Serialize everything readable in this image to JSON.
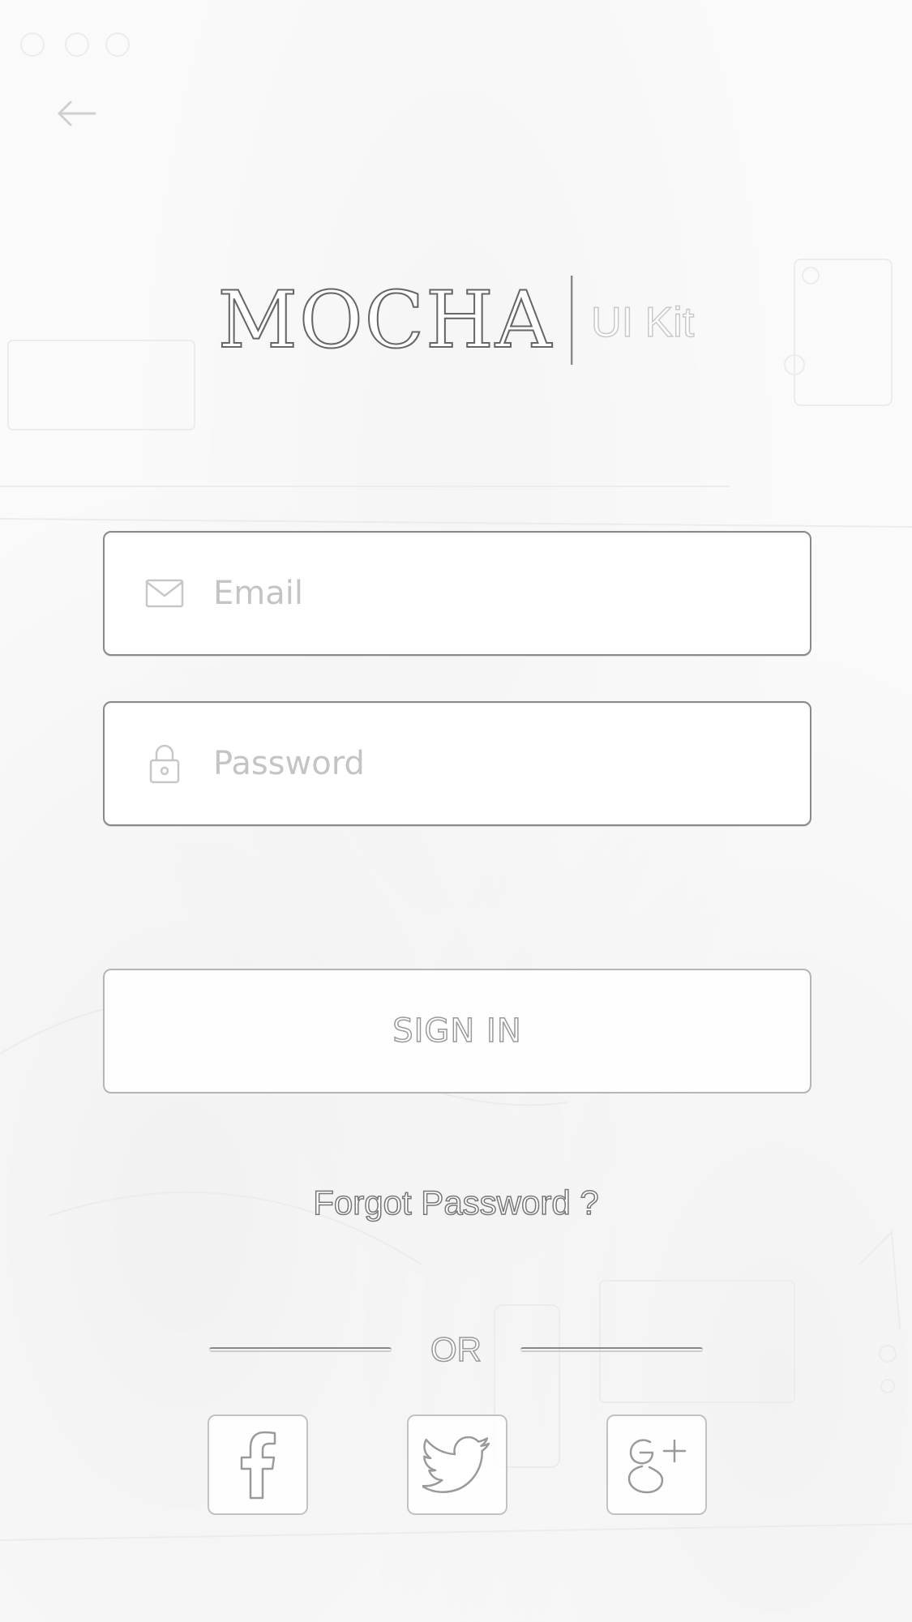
{
  "header": {
    "back_icon": "back-arrow-icon"
  },
  "logo": {
    "brand": "MOCHA",
    "subtitle": "UI Kit"
  },
  "form": {
    "email": {
      "placeholder": "Email",
      "value": "",
      "icon": "envelope-icon"
    },
    "password": {
      "placeholder": "Password",
      "value": "",
      "icon": "padlock-icon"
    },
    "sign_in_label": "SIGN IN",
    "forgot_label": "Forgot Password ?"
  },
  "social": {
    "divider_label": "OR",
    "buttons": [
      {
        "icon": "facebook-icon"
      },
      {
        "icon": "twitter-icon"
      },
      {
        "icon": "google-plus-icon"
      }
    ]
  },
  "colors": {
    "background": "#fafafa",
    "outline": "#8a8a8a",
    "placeholder": "#c4c4c4"
  }
}
